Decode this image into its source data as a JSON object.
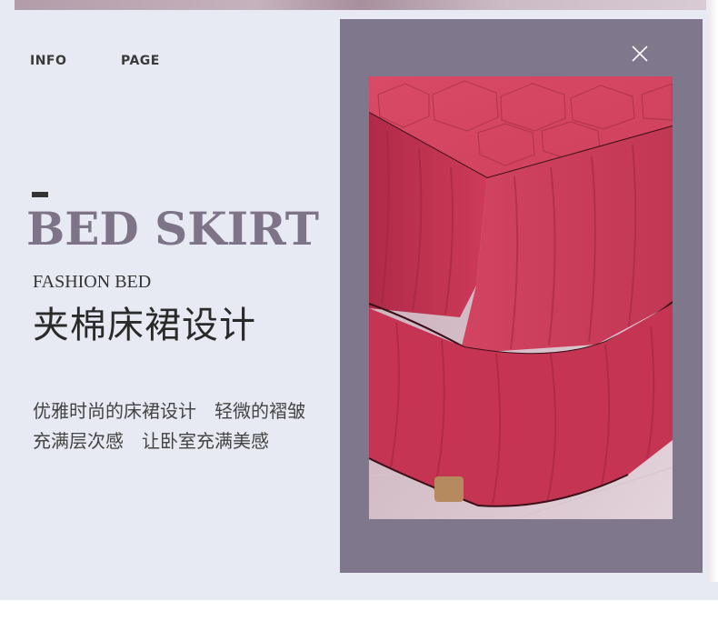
{
  "nav": {
    "items": [
      "INFO",
      "PAGE"
    ]
  },
  "hero": {
    "headline": "BED SKIRT",
    "subheadline": "FASHION BED",
    "title_cn": "夹棉床裙设计",
    "description_lines": [
      "优雅时尚的床裙设计　轻微的褶皱",
      "充满层次感　让卧室充满美感"
    ]
  },
  "icons": {
    "close": "close-icon"
  },
  "colors": {
    "page_background": "#e7eaf3",
    "panel": "#7f788d",
    "headline": "#7d7488",
    "fabric": "#c93a57",
    "trim": "#3a1018"
  }
}
